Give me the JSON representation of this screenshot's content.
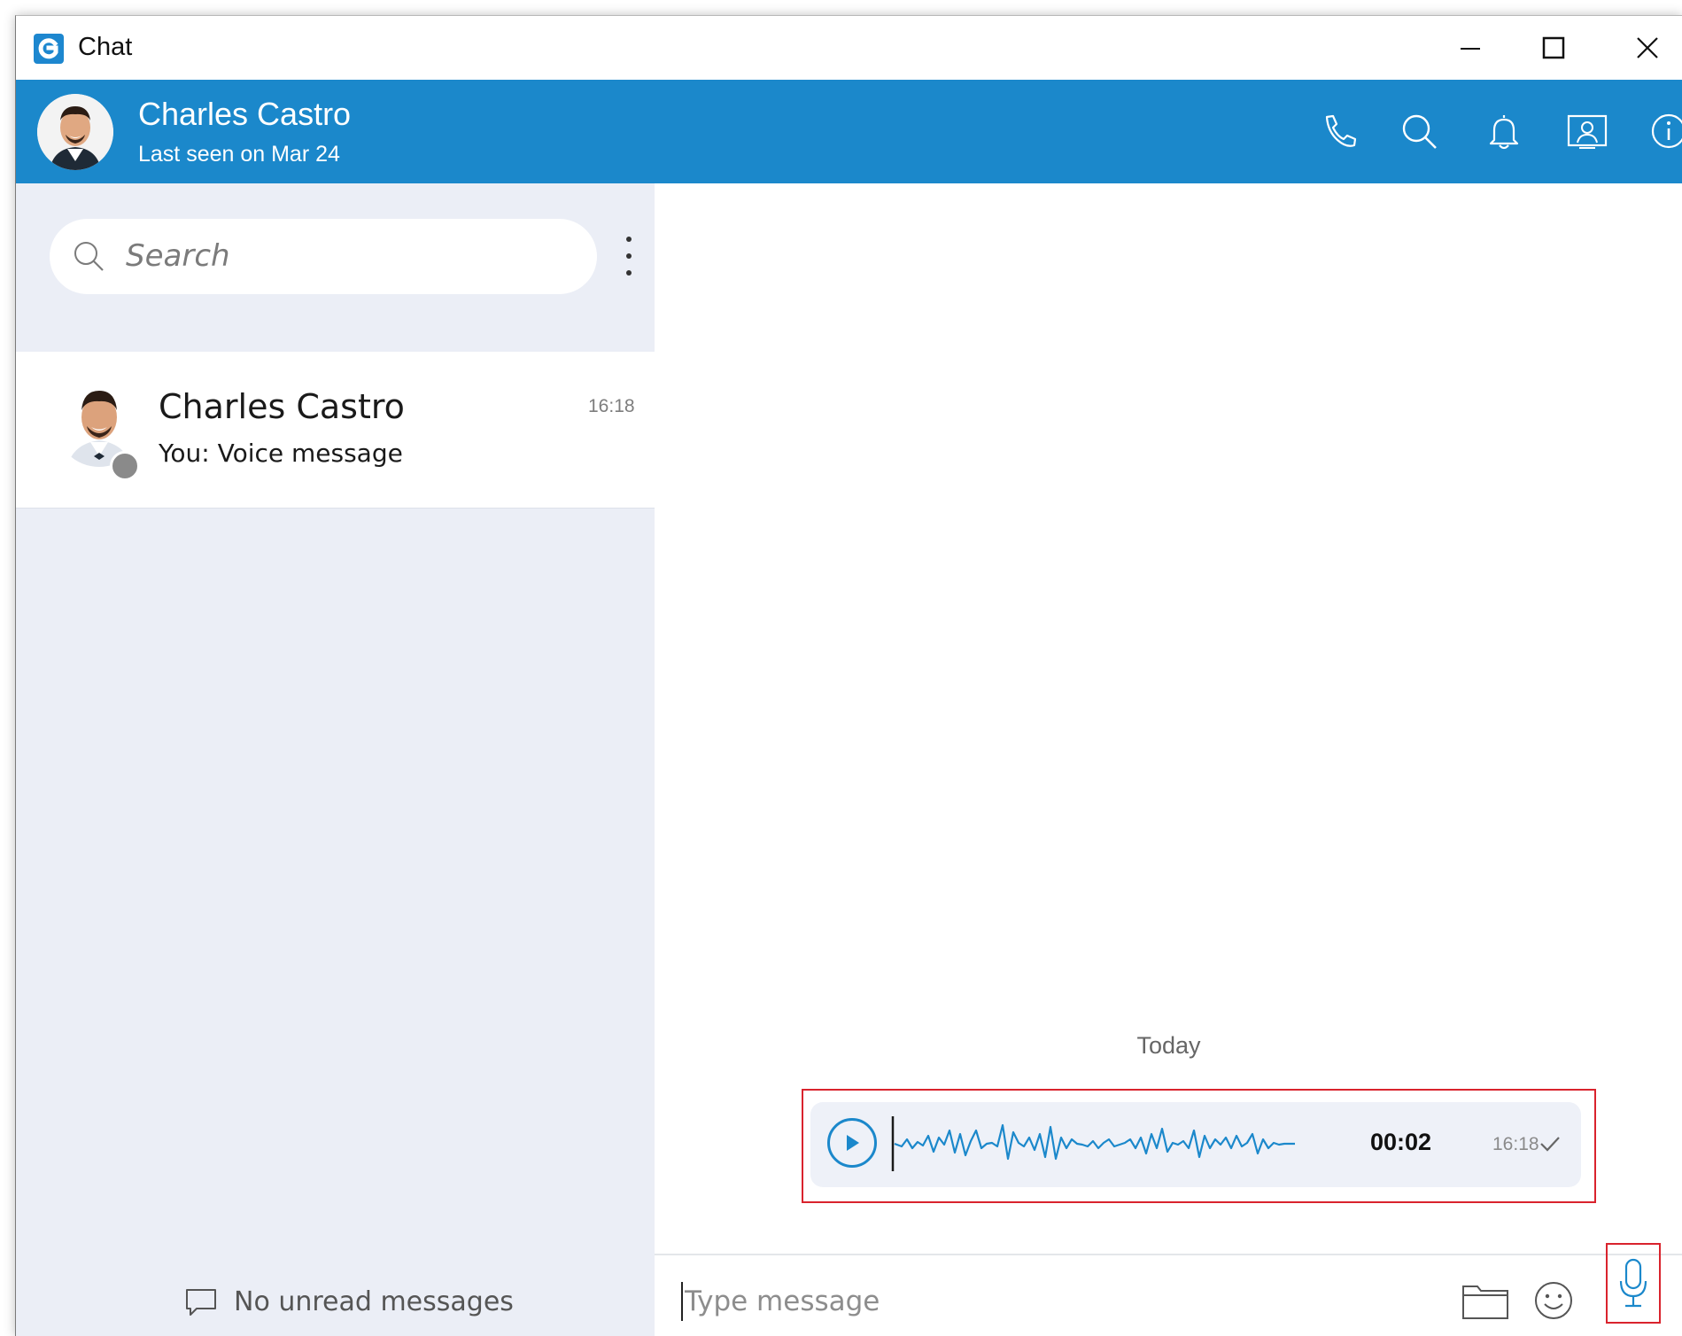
{
  "window": {
    "title": "Chat",
    "controls": [
      "minimize-icon",
      "maximize-icon",
      "close-icon"
    ]
  },
  "header": {
    "contact_name": "Charles Castro",
    "contact_status": "Last seen on Mar 24",
    "actions": [
      "phone-icon",
      "search-icon",
      "bell-icon",
      "contact-card-icon",
      "info-icon"
    ],
    "accent_color": "#1b88cb"
  },
  "sidebar": {
    "search": {
      "placeholder": "Search",
      "value": ""
    },
    "chats": [
      {
        "name": "Charles Castro",
        "time": "16:18",
        "preview": "You: Voice message",
        "presence_color": "#8a8a8a"
      }
    ],
    "footer_text": "No unread messages"
  },
  "conversation": {
    "date_separator": "Today",
    "messages": [
      {
        "type": "voice",
        "duration": "00:02",
        "time": "16:18",
        "status_icon": "check-icon"
      }
    ]
  },
  "composer": {
    "placeholder": "Type message",
    "value": "",
    "actions": [
      "folder-icon",
      "emoji-icon",
      "microphone-icon"
    ]
  },
  "highlight_color": "#d9232d"
}
